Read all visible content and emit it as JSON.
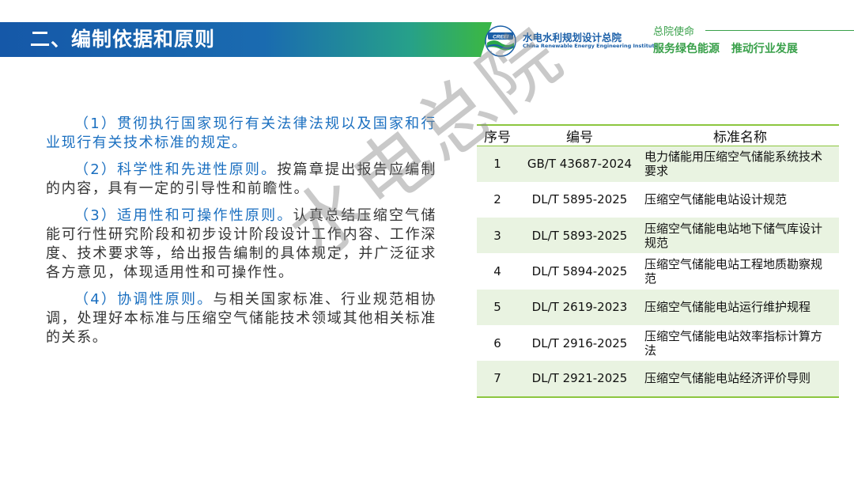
{
  "header": {
    "title": "二、编制依据和原则",
    "logo_badge": "CREEI",
    "logo_cn": "水电水利规划设计总院",
    "logo_en": "China Renewable Energy Engineering Institute",
    "mission_label": "总院使命",
    "mission_slogan": "服务绿色能源 推动行业发展"
  },
  "principles": [
    {
      "title": "（1）贯彻执行国家现行有关法律法规以及国家和行业现行有关技术标准的规定。",
      "body": ""
    },
    {
      "title": "（2）科学性和先进性原则。",
      "body": "按篇章提出报告应编制的内容，具有一定的引导性和前瞻性。"
    },
    {
      "title": "（3）适用性和可操作性原则。",
      "body": "认真总结压缩空气储能可行性研究阶段和初步设计阶段设计工作内容、工作深度、技术要求等，给出报告编制的具体规定，并广泛征求各方意见，体现适用性和可操作性。"
    },
    {
      "title": "（4）协调性原则。",
      "body": "与相关国家标准、行业规范相协调，处理好本标准与压缩空气储能技术领域其他相关标准的关系。"
    }
  ],
  "watermark": "水电总院",
  "table": {
    "headers": [
      "序号",
      "编号",
      "标准名称"
    ],
    "rows": [
      {
        "no": "1",
        "code": "GB/T 43687-2024",
        "name": "电力储能用压缩空气储能系统技术要求"
      },
      {
        "no": "2",
        "code": "DL/T 5895-2025",
        "name": "压缩空气储能电站设计规范"
      },
      {
        "no": "3",
        "code": "DL/T 5893-2025",
        "name": "压缩空气储能电站地下储气库设计规范"
      },
      {
        "no": "4",
        "code": "DL/T 5894-2025",
        "name": "压缩空气储能电站工程地质勘察规范"
      },
      {
        "no": "5",
        "code": "DL/T 2619-2023",
        "name": "压缩空气储能电站运行维护规程"
      },
      {
        "no": "6",
        "code": "DL/T 2916-2025",
        "name": "压缩空气储能电站效率指标计算方法"
      },
      {
        "no": "7",
        "code": "DL/T 2921-2025",
        "name": "压缩空气储能电站经济评价导则"
      }
    ]
  },
  "colors": {
    "title_blue": "#1558a8",
    "accent_green": "#39a04a",
    "text_blue": "#1a6fc0",
    "table_stripe": "#e9f3e1"
  }
}
